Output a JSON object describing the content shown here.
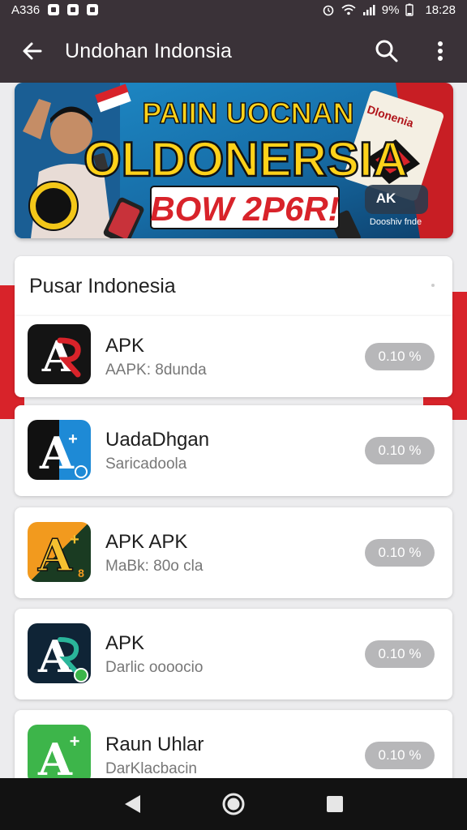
{
  "status_bar": {
    "carrier": "A336",
    "battery": "9%",
    "time": "18:28"
  },
  "app_bar": {
    "title": "Undohan Indonsia",
    "icons": [
      "back-arrow-icon",
      "search-icon",
      "more-vert-icon"
    ]
  },
  "banner": {
    "headline_1": "PAIIN UOCNAN",
    "headline_2": "OLDONERSIA",
    "headline_3": "BOW 2P6R!",
    "badge_text": "AK",
    "badge_sub": "Dooshiv fnde",
    "card_text": "Dlonenia"
  },
  "section": {
    "title": "Pusar Indonesia"
  },
  "apps": [
    {
      "name": "APK",
      "subtitle": "AAPK: 8dunda",
      "pill": "0.10 %",
      "icon": "red-a-icon"
    },
    {
      "name": "UadaDhgan",
      "subtitle": "Saricadoola",
      "pill": "0.10 %",
      "icon": "blue-a-icon"
    },
    {
      "name": "APK APK",
      "subtitle": "MaBk: 80o cla",
      "pill": "0.10 %",
      "icon": "orange-a-icon"
    },
    {
      "name": "APK",
      "subtitle": "Darlic oooocio",
      "pill": "0.10 %",
      "icon": "teal-a-icon"
    },
    {
      "name": "Raun Uhlar",
      "subtitle": "DarKlacbacin",
      "pill": "0.10 %",
      "icon": "green-a-icon"
    }
  ],
  "nav_bar": {
    "icons": [
      "back-triangle-icon",
      "home-circle-icon",
      "recents-square-icon"
    ]
  },
  "colors": {
    "bar": "#3a3238",
    "accent_red": "#d8232a",
    "pill": "#b7b7b9"
  }
}
